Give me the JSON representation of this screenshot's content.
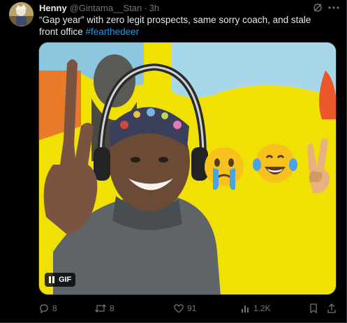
{
  "tweet": {
    "author_name": "Henny",
    "author_handle": "@Gintama__Stan",
    "separator": "·",
    "time": "3h",
    "text": "“Gap year” with zero legit prospects, same sorry coach, and stale front office ",
    "hashtag": "#fearthedeer"
  },
  "media": {
    "badge_label": "GIF",
    "emojis": [
      "crying-face",
      "tears-of-joy-face",
      "victory-hand"
    ]
  },
  "actions": {
    "replies": "8",
    "reposts": "8",
    "likes": "91",
    "views": "1.2K"
  },
  "colors": {
    "background": "#000000",
    "text": "#e7e9ea",
    "muted": "#71767b",
    "link": "#1d9bf0",
    "gif_background": "#f2e203"
  },
  "icons": [
    "grok-icon",
    "more-icon",
    "pause-icon",
    "reply-icon",
    "repost-icon",
    "like-icon",
    "views-icon",
    "bookmark-icon",
    "share-icon"
  ]
}
